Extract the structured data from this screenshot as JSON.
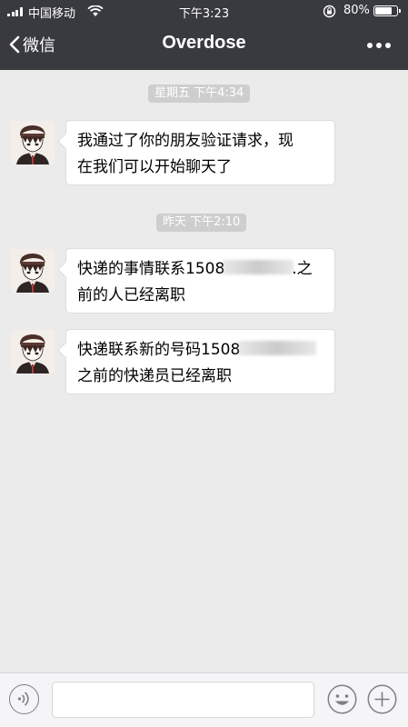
{
  "status_bar": {
    "carrier": "中国移动",
    "time": "下午3:23",
    "battery_percent": "80%",
    "battery_level": 0.8
  },
  "nav": {
    "back_label": "微信",
    "title": "Overdose"
  },
  "messages": [
    {
      "timestamp": "星期五 下午4:34",
      "lines": [
        "我通过了你的朋友验证请求，现",
        "在我们可以开始聊天了"
      ]
    },
    {
      "timestamp": "昨天 下午2:10",
      "line1_before": "快递的事情联系1508",
      "line1_after": ".之",
      "line2": "前的人已经离职"
    },
    {
      "line1_before": "快递联系新的号码1508",
      "line2": "之前的快递员已经离职"
    }
  ],
  "icons": {
    "back": "chevron-left-icon",
    "more": "more-dots-icon",
    "voice": "voice-icon",
    "emoji": "emoji-icon",
    "plus": "plus-icon",
    "wifi": "wifi-icon",
    "rotation_lock": "rotation-lock-icon"
  }
}
